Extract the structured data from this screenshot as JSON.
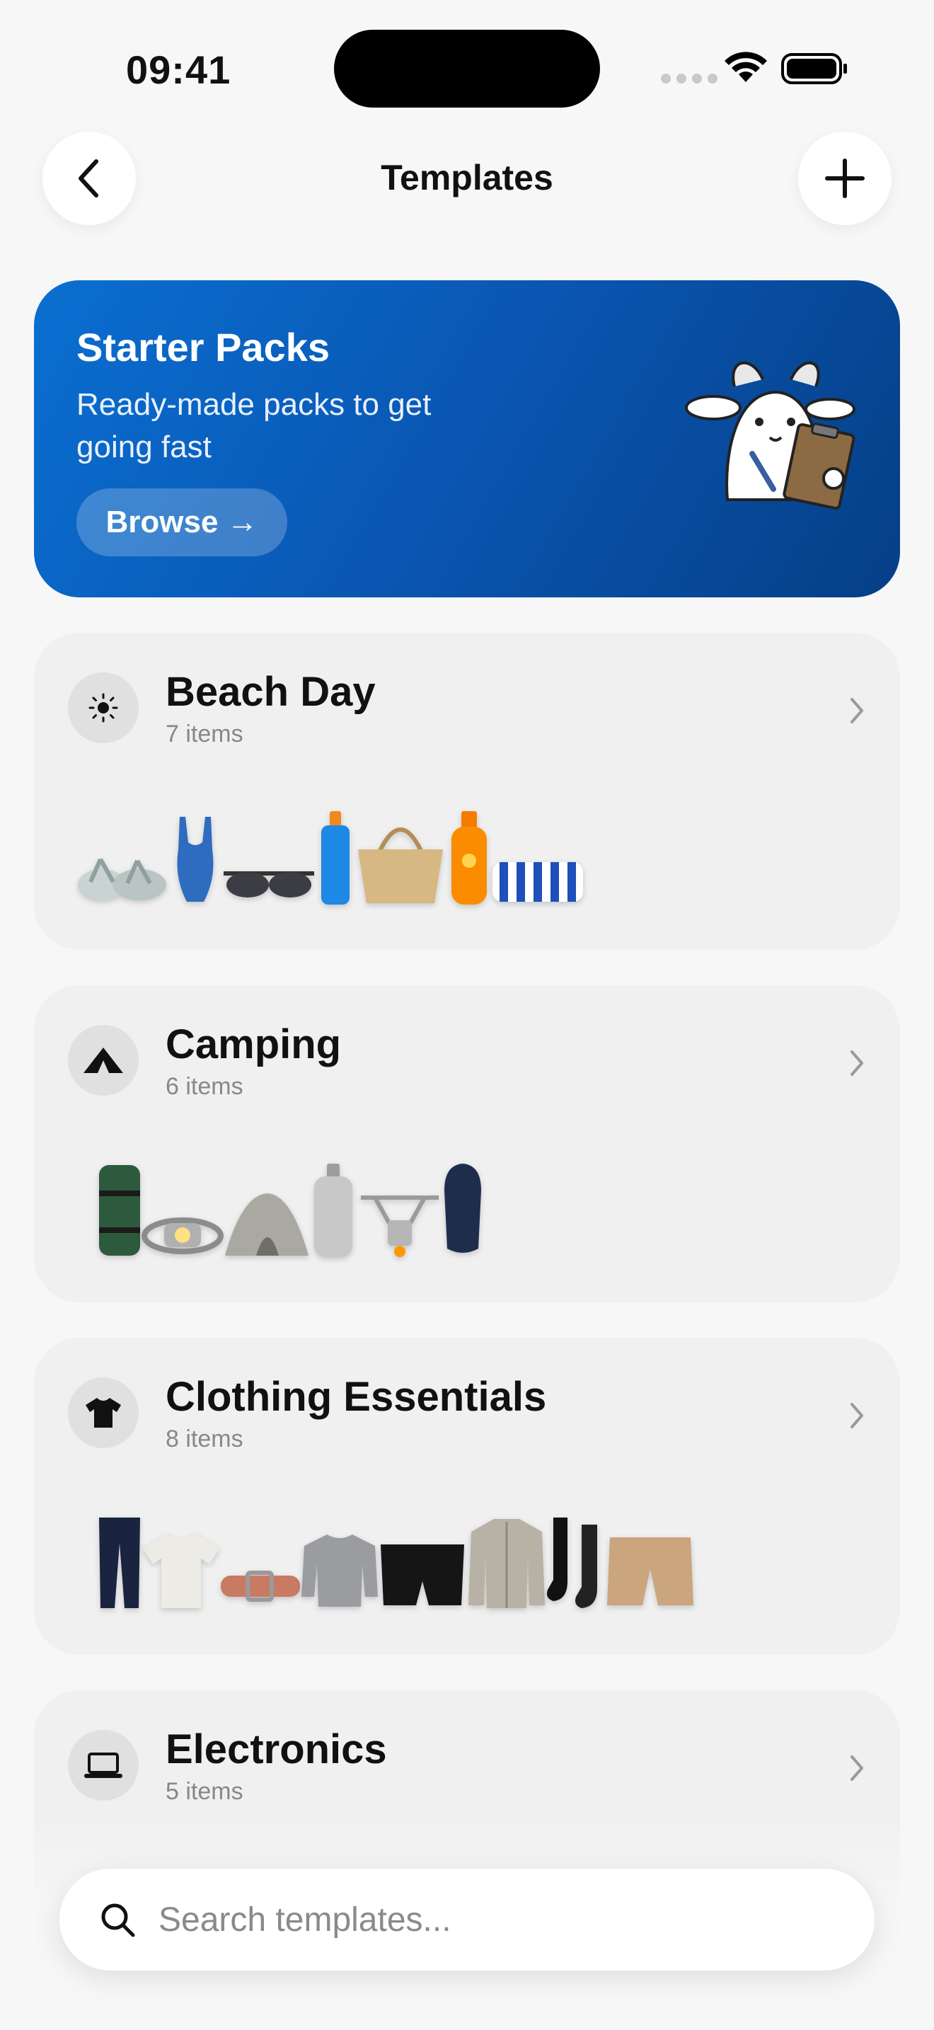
{
  "status_bar": {
    "time": "09:41"
  },
  "nav": {
    "title": "Templates",
    "back_icon": "chevron-left-icon",
    "add_icon": "plus-icon"
  },
  "banner": {
    "title": "Starter Packs",
    "subtitle": "Ready-made packs to get going fast",
    "button_label": "Browse",
    "button_arrow": "→",
    "colors": {
      "start": "#0a6fd1",
      "end": "#053f86"
    }
  },
  "templates": [
    {
      "title": "Beach Day",
      "count": "7 items",
      "icon": "sun-icon",
      "items": [
        "flip-flops",
        "swimsuit",
        "sunglasses",
        "sunscreen-bottle",
        "straw-bag",
        "sun-lotion",
        "beach-towel"
      ]
    },
    {
      "title": "Camping",
      "count": "6 items",
      "icon": "tent-icon",
      "items": [
        "sleeping-mat",
        "headlamp",
        "tent",
        "gas-canister",
        "camp-stove",
        "sleeping-bag"
      ]
    },
    {
      "title": "Clothing Essentials",
      "count": "8 items",
      "icon": "tshirt-icon",
      "items": [
        "jeans",
        "t-shirt",
        "belt",
        "sweater",
        "boxers",
        "jacket",
        "socks",
        "shorts"
      ]
    },
    {
      "title": "Electronics",
      "count": "5 items",
      "icon": "laptop-icon",
      "items": []
    }
  ],
  "search": {
    "placeholder": "Search templates...",
    "value": ""
  }
}
